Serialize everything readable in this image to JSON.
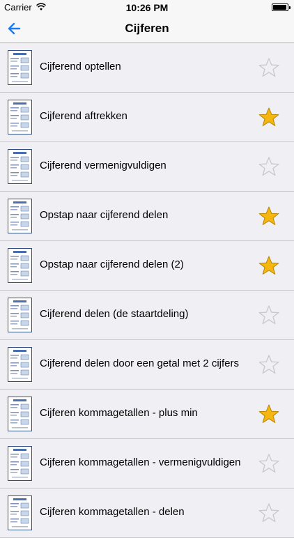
{
  "status_bar": {
    "carrier": "Carrier",
    "time": "10:26 PM",
    "battery_level": 0.95
  },
  "nav": {
    "title": "Cijferen",
    "back_icon": "back-arrow-icon"
  },
  "accent_color": "#1a7cf4",
  "star_filled_color": "#f5b70f",
  "items": [
    {
      "label": "Cijferend optellen",
      "favorite": false
    },
    {
      "label": "Cijferend aftrekken",
      "favorite": true
    },
    {
      "label": "Cijferend vermenigvuldigen",
      "favorite": false
    },
    {
      "label": "Opstap naar cijferend delen",
      "favorite": true
    },
    {
      "label": "Opstap naar cijferend delen (2)",
      "favorite": true
    },
    {
      "label": "Cijferend delen (de staartdeling)",
      "favorite": false
    },
    {
      "label": "Cijferend delen door een getal met 2 cijfers",
      "favorite": false
    },
    {
      "label": "Cijferen kommagetallen - plus min",
      "favorite": true
    },
    {
      "label": "Cijferen kommagetallen - vermenigvuldigen",
      "favorite": false
    },
    {
      "label": "Cijferen kommagetallen - delen",
      "favorite": false
    }
  ]
}
